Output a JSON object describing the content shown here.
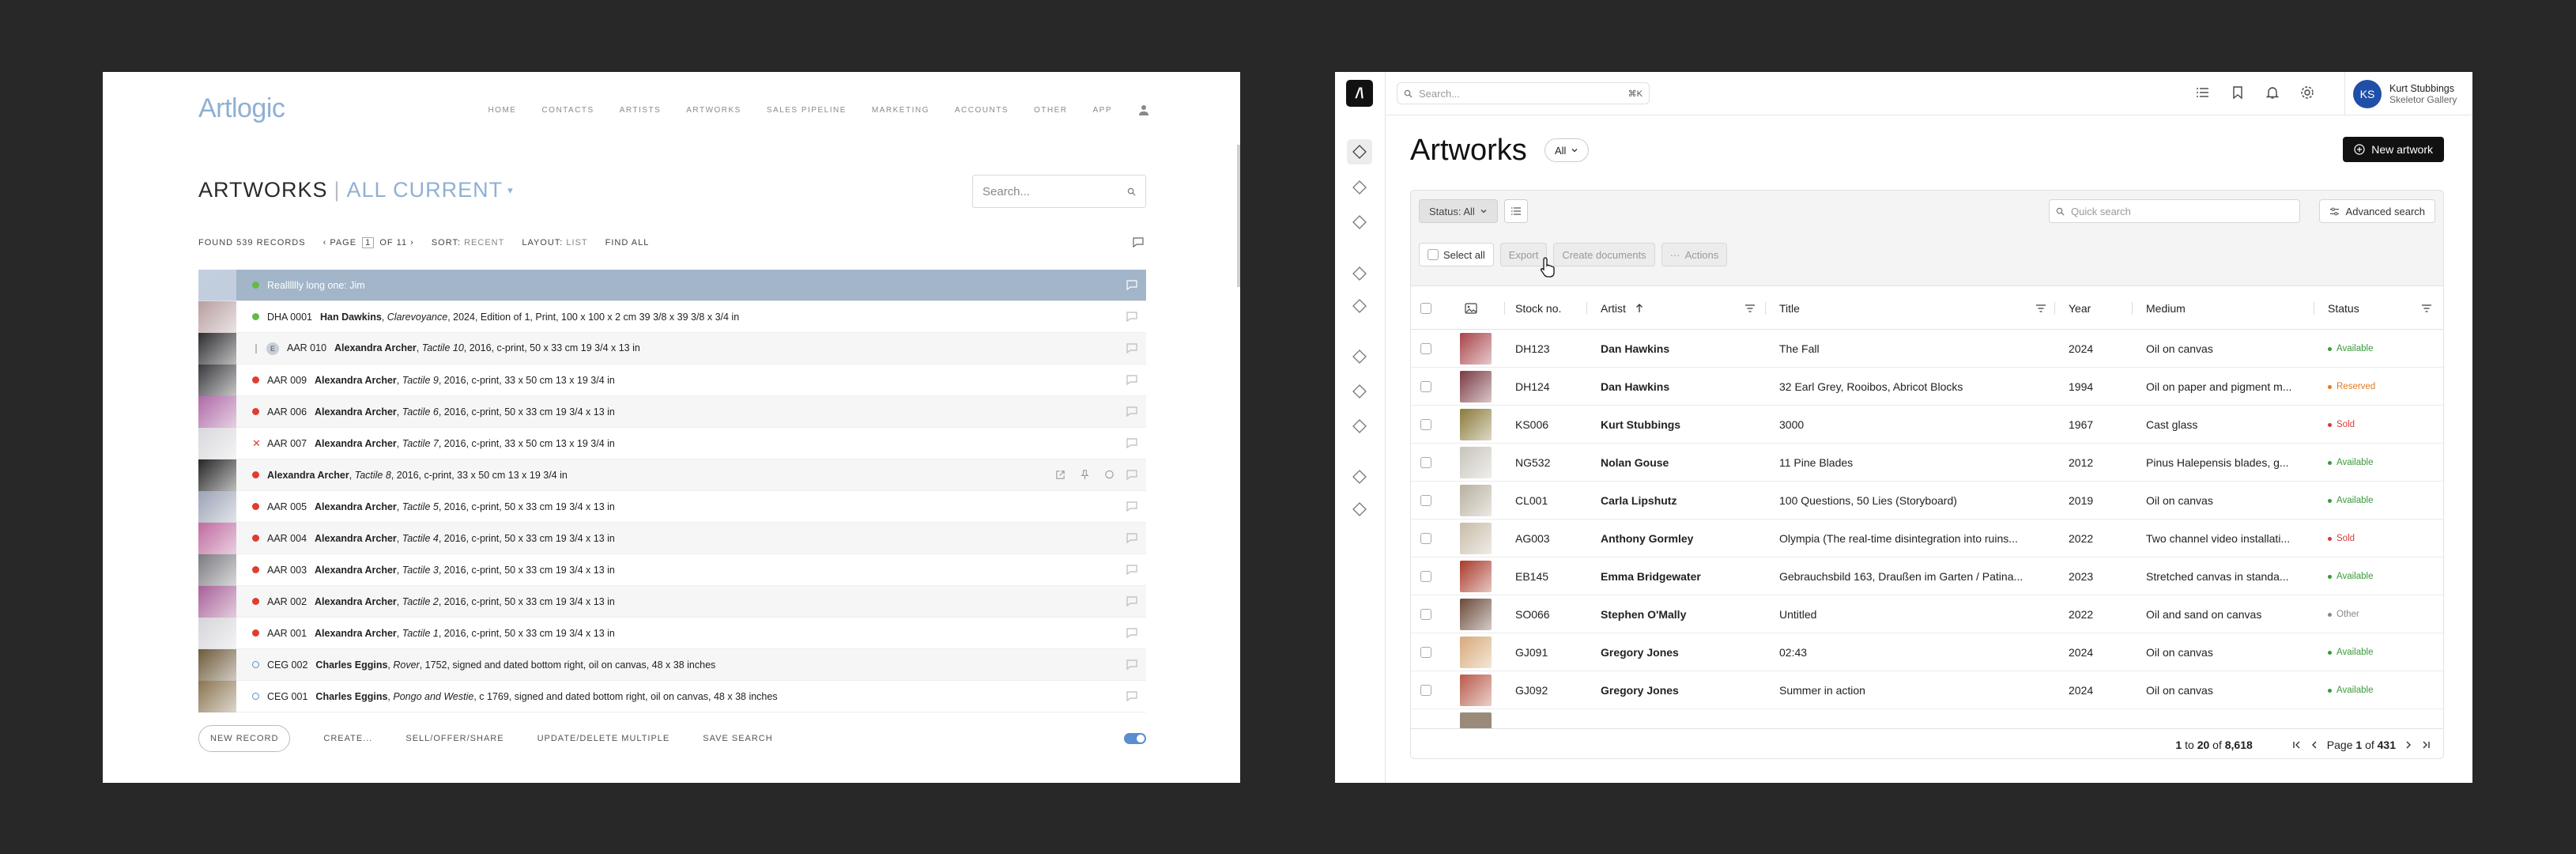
{
  "artlogic": {
    "logo": "Artlogic",
    "nav": [
      "HOME",
      "CONTACTS",
      "ARTISTS",
      "ARTWORKS",
      "SALES PIPELINE",
      "MARKETING",
      "ACCOUNTS",
      "OTHER",
      "APP"
    ],
    "title": "ARTWORKS",
    "subtitle": "ALL CURRENT",
    "search_placeholder": "Search...",
    "found": "FOUND 539 RECORDS",
    "page_label": "PAGE",
    "page_current": "1",
    "page_of": "OF 11",
    "sort_label": "SORT:",
    "sort_value": "RECENT",
    "layout_label": "LAYOUT:",
    "layout_value": "LIST",
    "find_all": "FIND ALL",
    "rows": [
      {
        "code": "",
        "artist": "",
        "title": "",
        "details": "",
        "special": "Realllllly long one: Jim",
        "status": "green",
        "thumb": "#c3cfe0"
      },
      {
        "code": "DHA 0001",
        "artist": "Han Dawkins",
        "title": "Clarevoyance",
        "details": ", 2024, Edition of 1, Print, 100 x 100 x 2 cm 39 3/8 x 39 3/8 x 3/4 in",
        "status": "green",
        "thumb": "#b89ea0"
      },
      {
        "code": "AAR 010",
        "artist": "Alexandra Archer",
        "title": "Tactile 10",
        "details": ", 2016, c-print, 50 x 33 cm 19 3/4 x 13 in",
        "status": "pipe",
        "badge": "E",
        "thumb": "#2d2d30"
      },
      {
        "code": "AAR 009",
        "artist": "Alexandra Archer",
        "title": "Tactile 9",
        "details": ", 2016, c-print, 33 x 50 cm 13 x 19 3/4 in",
        "status": "red",
        "thumb": "#3a3a3e"
      },
      {
        "code": "AAR 006",
        "artist": "Alexandra Archer",
        "title": "Tactile 6",
        "details": ", 2016, c-print, 50 x 33 cm 19 3/4 x 13 in",
        "status": "red",
        "thumb": "#b06aa8"
      },
      {
        "code": "AAR 007",
        "artist": "Alexandra Archer",
        "title": "Tactile 7",
        "details": ", 2016, c-print, 33 x 50 cm 13 x 19 3/4 in",
        "status": "x",
        "thumb": "#d8d8dc"
      },
      {
        "code": "",
        "artist": "Alexandra Archer",
        "title": "Tactile 8",
        "details": ", 2016, c-print, 33 x 50 cm 13 x 19 3/4 in",
        "status": "red",
        "thumb": "#262628",
        "hover": true
      },
      {
        "code": "AAR 005",
        "artist": "Alexandra Archer",
        "title": "Tactile 5",
        "details": ", 2016, c-print, 50 x 33 cm 19 3/4 x 13 in",
        "status": "red",
        "thumb": "#9aa2b5"
      },
      {
        "code": "AAR 004",
        "artist": "Alexandra Archer",
        "title": "Tactile 4",
        "details": ", 2016, c-print, 50 x 33 cm 19 3/4 x 13 in",
        "status": "red",
        "thumb": "#c06aa0"
      },
      {
        "code": "AAR 003",
        "artist": "Alexandra Archer",
        "title": "Tactile 3",
        "details": ", 2016, c-print, 50 x 33 cm 19 3/4 x 13 in",
        "status": "red",
        "thumb": "#7a7a80"
      },
      {
        "code": "AAR 002",
        "artist": "Alexandra Archer",
        "title": "Tactile 2",
        "details": ", 2016, c-print, 50 x 33 cm 19 3/4 x 13 in",
        "status": "red",
        "thumb": "#a86098"
      },
      {
        "code": "AAR 001",
        "artist": "Alexandra Archer",
        "title": "Tactile 1",
        "details": ", 2016, c-print, 50 x 33 cm 19 3/4 x 13 in",
        "status": "red",
        "thumb": "#d5d5da"
      },
      {
        "code": "CEG 002",
        "artist": "Charles Eggins",
        "title": "Rover",
        "details": ", 1752, signed and dated bottom right, oil on canvas, 48 x 38 inches",
        "status": "ring",
        "thumb": "#6e5a3a"
      },
      {
        "code": "CEG 001",
        "artist": "Charles Eggins",
        "title": "Pongo and Westie",
        "details": ", c 1769, signed and dated bottom right, oil on canvas, 48 x 38 inches",
        "status": "ring",
        "thumb": "#8a7450"
      }
    ],
    "footer": {
      "new_record": "NEW RECORD",
      "create": "CREATE...",
      "sell": "SELL/OFFER/SHARE",
      "update": "UPDATE/DELETE MULTIPLE",
      "save_search": "SAVE SEARCH"
    },
    "colors": {
      "accent": "#8eb0d4",
      "selected_row": "#a2b5c9"
    }
  },
  "arternal": {
    "logo": "/\\",
    "search_placeholder": "Search...",
    "search_kbd": "⌘K",
    "user": {
      "initials": "KS",
      "name": "Kurt Stubbings",
      "gallery": "Skeletor Gallery"
    },
    "title": "Artworks",
    "all_filter": "All",
    "new_button": "New artwork",
    "status_filter": "Status: All",
    "quick_search_placeholder": "Quick search",
    "advanced_search": "Advanced search",
    "select_all": "Select all",
    "export": "Export",
    "create_documents": "Create documents",
    "actions": "Actions",
    "columns": {
      "stock": "Stock no.",
      "artist": "Artist",
      "title": "Title",
      "year": "Year",
      "medium": "Medium",
      "status": "Status"
    },
    "rows": [
      {
        "stock": "DH123",
        "artist": "Dan Hawkins",
        "title": "The Fall",
        "year": "2024",
        "medium": "Oil on canvas",
        "status": "Available",
        "thumb": "#a8444a"
      },
      {
        "stock": "DH124",
        "artist": "Dan Hawkins",
        "title": "32 Earl Grey, Rooibos, Abricot Blocks",
        "year": "1994",
        "medium": "Oil on paper and pigment m...",
        "status": "Reserved",
        "thumb": "#7a3a44"
      },
      {
        "stock": "KS006",
        "artist": "Kurt Stubbings",
        "title": "3000",
        "year": "1967",
        "medium": "Cast glass",
        "status": "Sold",
        "thumb": "#8a7a3a"
      },
      {
        "stock": "NG532",
        "artist": "Nolan Gouse",
        "title": "11 Pine Blades",
        "year": "2012",
        "medium": "Pinus Halepensis blades, g...",
        "status": "Available",
        "thumb": "#c8c4bc"
      },
      {
        "stock": "CL001",
        "artist": "Carla Lipshutz",
        "title": "100 Questions, 50 Lies (Storyboard)",
        "year": "2019",
        "medium": "Oil on canvas",
        "status": "Available",
        "thumb": "#b8b0a0"
      },
      {
        "stock": "AG003",
        "artist": "Anthony Gormley",
        "title": "Olympia (The real-time disintegration into ruins...",
        "year": "2022",
        "medium": "Two channel video installati...",
        "status": "Sold",
        "thumb": "#c8bca8"
      },
      {
        "stock": "EB145",
        "artist": "Emma Bridgewater",
        "title": "Gebrauchsbild 163, Draußen im Garten / Patina...",
        "year": "2023",
        "medium": "Stretched canvas in standa...",
        "status": "Available",
        "thumb": "#a83a2a"
      },
      {
        "stock": "SO066",
        "artist": "Stephen O'Mally",
        "title": "Untitled",
        "year": "2022",
        "medium": "Oil and sand on canvas",
        "status": "Other",
        "thumb": "#6a4a3a"
      },
      {
        "stock": "GJ091",
        "artist": "Gregory Jones",
        "title": "02:43",
        "year": "2024",
        "medium": "Oil on canvas",
        "status": "Available",
        "thumb": "#d8a878"
      },
      {
        "stock": "GJ092",
        "artist": "Gregory Jones",
        "title": "Summer in action",
        "year": "2024",
        "medium": "Oil on canvas",
        "status": "Available",
        "thumb": "#b85a4a"
      }
    ],
    "pager": {
      "range_start": "1",
      "to": "to",
      "range_end": "20",
      "of": "of",
      "total": "8,618",
      "page_label": "Page",
      "page": "1",
      "page_of": "of",
      "pages": "431"
    },
    "status_colors": {
      "Available": "#3a9a3a",
      "Reserved": "#e07a20",
      "Sold": "#d83a3a",
      "Other": "#888888"
    }
  }
}
